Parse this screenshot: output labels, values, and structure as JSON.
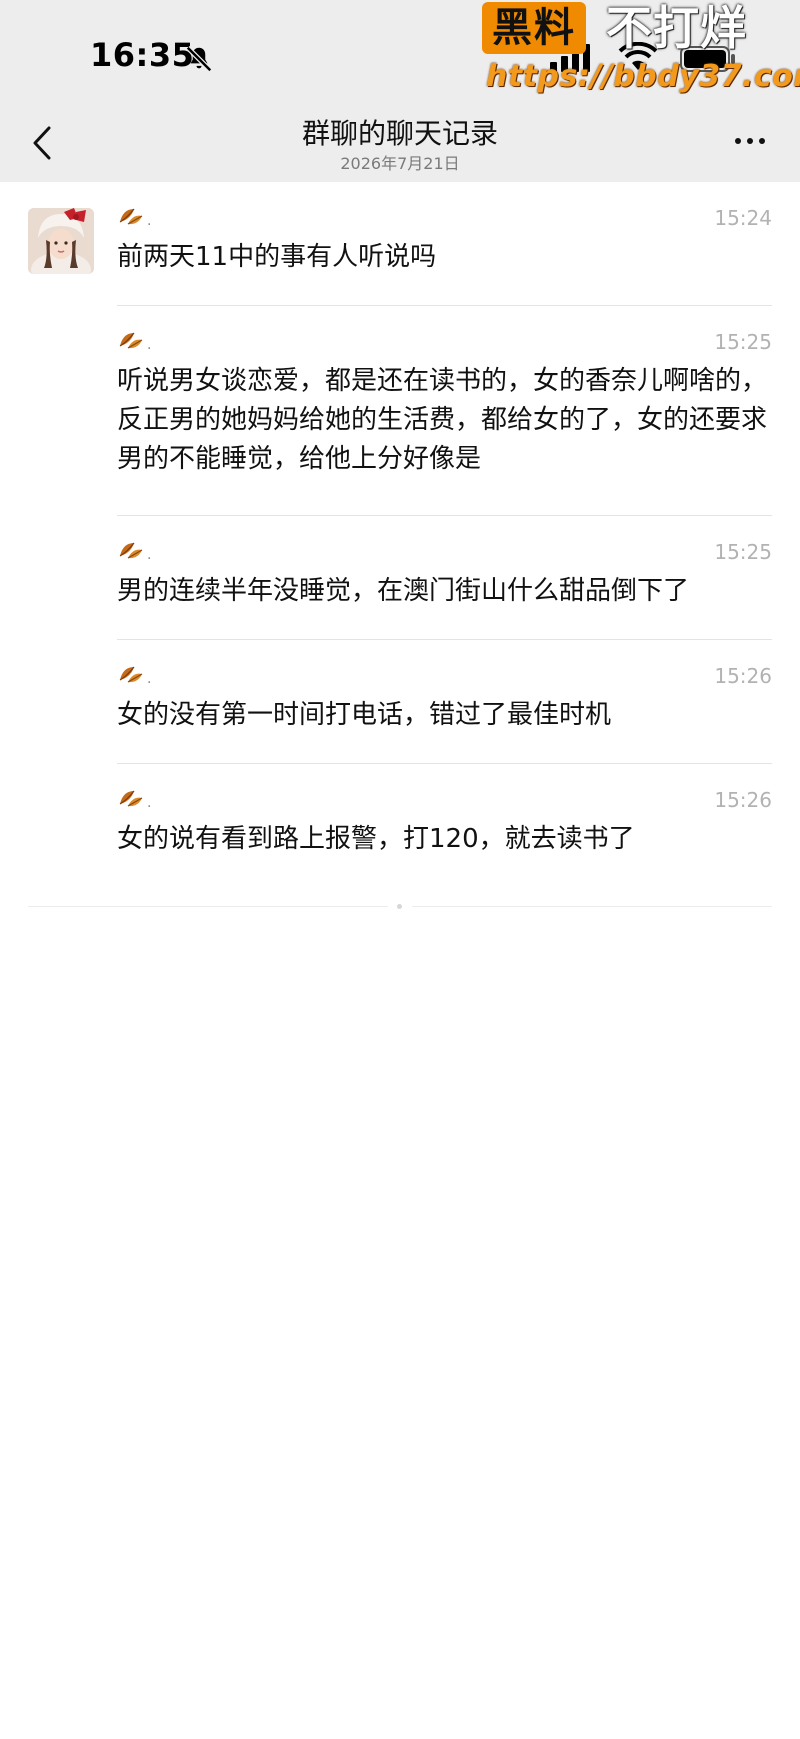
{
  "status_bar": {
    "time": "16:35"
  },
  "watermark": {
    "badge": "黑料",
    "text": "不打烊",
    "url": "https://bbdy37.com"
  },
  "nav": {
    "title": "群聊的聊天记录",
    "subtitle": "2026年7月21日"
  },
  "messages": [
    {
      "time": "15:24",
      "text": "前两天11中的事有人听说吗"
    },
    {
      "time": "15:25",
      "text": "听说男女谈恋爱，都是还在读书的，女的香奈儿啊啥的，反正男的她妈妈给她的生活费，都给女的了，女的还要求男的不能睡觉，给他上分好像是"
    },
    {
      "time": "15:25",
      "text": "男的连续半年没睡觉，在澳门街山什么甜品倒下了"
    },
    {
      "time": "15:26",
      "text": "女的没有第一时间打电话，错过了最佳时机"
    },
    {
      "time": "15:26",
      "text": "女的说有看到路上报警，打120，就去读书了"
    }
  ],
  "colors": {
    "nav_bg": "#ededed",
    "time_gray": "#b2b2b2",
    "watermark_orange": "#f08a00"
  },
  "icons": [
    "bell-slash-icon",
    "signal-icon",
    "wifi-icon",
    "battery-icon",
    "back-chevron-icon",
    "more-dots-icon",
    "leaf-emoji-icon"
  ]
}
